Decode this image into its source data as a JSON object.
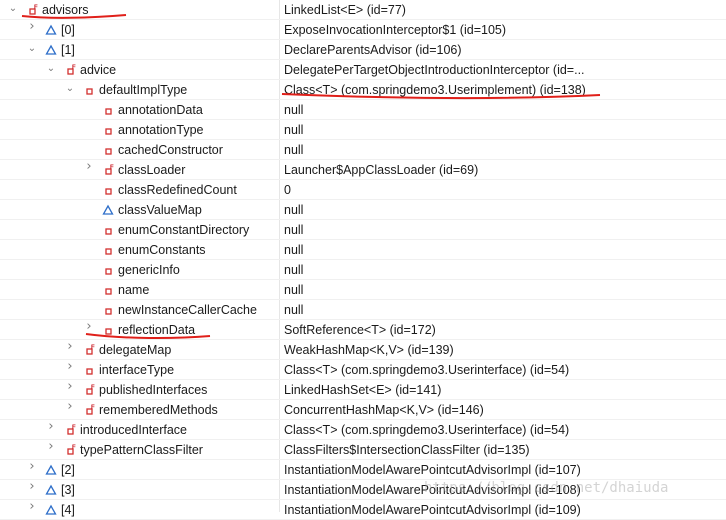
{
  "colors": {
    "accent_red": "#e0201a",
    "private_field": "#d3302e",
    "package_field": "#2f6fc9",
    "final_mark": "#c8141e"
  },
  "rows": [
    {
      "name": "advisors",
      "value": "LinkedList<E>  (id=77)",
      "expand": "down",
      "icon": "private-final-field-icon"
    },
    {
      "name": "[0]",
      "value": "ExposeInvocationInterceptor$1  (id=105)",
      "expand": "right",
      "icon": "package-field-icon"
    },
    {
      "name": "[1]",
      "value": "DeclareParentsAdvisor  (id=106)",
      "expand": "down",
      "icon": "package-field-icon"
    },
    {
      "name": "advice",
      "value": "DelegatePerTargetObjectIntroductionInterceptor  (id=...",
      "expand": "down",
      "icon": "final-field-icon"
    },
    {
      "name": "defaultImplType",
      "value": "Class<T> (com.springdemo3.Userimplement) (id=138)",
      "expand": "down",
      "icon": "private-field-icon"
    },
    {
      "name": "annotationData",
      "value": "null",
      "expand": "none",
      "icon": "private-field-icon"
    },
    {
      "name": "annotationType",
      "value": "null",
      "expand": "none",
      "icon": "private-field-icon"
    },
    {
      "name": "cachedConstructor",
      "value": "null",
      "expand": "none",
      "icon": "private-field-icon"
    },
    {
      "name": "classLoader",
      "value": "Launcher$AppClassLoader  (id=69)",
      "expand": "right",
      "icon": "private-final-field-icon"
    },
    {
      "name": "classRedefinedCount",
      "value": "0",
      "expand": "none",
      "icon": "private-field-icon"
    },
    {
      "name": "classValueMap",
      "value": "null",
      "expand": "none",
      "icon": "package-field-icon"
    },
    {
      "name": "enumConstantDirectory",
      "value": "null",
      "expand": "none",
      "icon": "private-field-icon"
    },
    {
      "name": "enumConstants",
      "value": "null",
      "expand": "none",
      "icon": "private-field-icon"
    },
    {
      "name": "genericInfo",
      "value": "null",
      "expand": "none",
      "icon": "private-field-icon"
    },
    {
      "name": "name",
      "value": "null",
      "expand": "none",
      "icon": "private-field-icon"
    },
    {
      "name": "newInstanceCallerCache",
      "value": "null",
      "expand": "none",
      "icon": "private-field-icon"
    },
    {
      "name": "reflectionData",
      "value": "SoftReference<T>  (id=172)",
      "expand": "right",
      "icon": "private-field-icon"
    },
    {
      "name": "delegateMap",
      "value": "WeakHashMap<K,V>  (id=139)",
      "expand": "right",
      "icon": "private-final-field-icon"
    },
    {
      "name": "interfaceType",
      "value": "Class<T> (com.springdemo3.Userinterface) (id=54)",
      "expand": "right",
      "icon": "private-field-icon"
    },
    {
      "name": "publishedInterfaces",
      "value": "LinkedHashSet<E>  (id=141)",
      "expand": "right",
      "icon": "private-final-field-icon"
    },
    {
      "name": "rememberedMethods",
      "value": "ConcurrentHashMap<K,V>  (id=146)",
      "expand": "right",
      "icon": "private-final-field-icon"
    },
    {
      "name": "introducedInterface",
      "value": "Class<T> (com.springdemo3.Userinterface) (id=54)",
      "expand": "right",
      "icon": "final-field-icon"
    },
    {
      "name": "typePatternClassFilter",
      "value": "ClassFilters$IntersectionClassFilter  (id=135)",
      "expand": "right",
      "icon": "final-field-icon"
    },
    {
      "name": "[2]",
      "value": "InstantiationModelAwarePointcutAdvisorImpl  (id=107)",
      "expand": "right",
      "icon": "package-field-icon"
    },
    {
      "name": "[3]",
      "value": "InstantiationModelAwarePointcutAdvisorImpl  (id=108)",
      "expand": "right",
      "icon": "package-field-icon"
    },
    {
      "name": "[4]",
      "value": "InstantiationModelAwarePointcutAdvisorImpl  (id=109)",
      "expand": "right",
      "icon": "package-field-icon"
    }
  ],
  "watermark": "https://blog.csdn.net/dhaiuda"
}
